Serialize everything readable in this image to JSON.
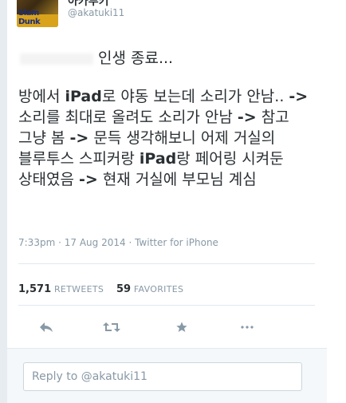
{
  "user": {
    "display_name": "아카투키",
    "handle": "@akatuki11",
    "avatar_logo_text": "Slam Dunk"
  },
  "tweet": {
    "first_line": "인생 종료...",
    "body": [
      {
        "t": "방에서 ",
        "b": false
      },
      {
        "t": "iPad",
        "b": true
      },
      {
        "t": "로 야동 보는데 소리가 안남.. ",
        "b": false
      },
      {
        "t": "->",
        "b": true
      },
      {
        "t": " 소리를 최대로 올려도 소리가 안남 ",
        "b": false
      },
      {
        "t": "->",
        "b": true
      },
      {
        "t": " 참고 그냥 봄 ",
        "b": false
      },
      {
        "t": "->",
        "b": true
      },
      {
        "t": " 문득 생각해보니 어제 거실의 블루투스 스피커랑 ",
        "b": false
      },
      {
        "t": "iPad",
        "b": true
      },
      {
        "t": "랑 페어링 시켜둔 상태였음 ",
        "b": false
      },
      {
        "t": "->",
        "b": true
      },
      {
        "t": " 현재 거실에 부모님 계심",
        "b": false
      }
    ],
    "time": "7:33pm",
    "date": "17 Aug 2014",
    "source": "Twitter for iPhone"
  },
  "stats": {
    "retweets_count": "1,571",
    "retweets_label": "RETWEETS",
    "favorites_count": "59",
    "favorites_label": "FAVORITES"
  },
  "actions": [
    {
      "name": "reply-icon"
    },
    {
      "name": "retweet-icon"
    },
    {
      "name": "favorite-icon"
    },
    {
      "name": "more-icon"
    }
  ],
  "reply": {
    "placeholder": "Reply to @akatuki11"
  },
  "colors": {
    "text": "#292f33",
    "muted": "#8899a6",
    "border": "#e1e8ed",
    "reply_bg": "#f5f8fa"
  }
}
